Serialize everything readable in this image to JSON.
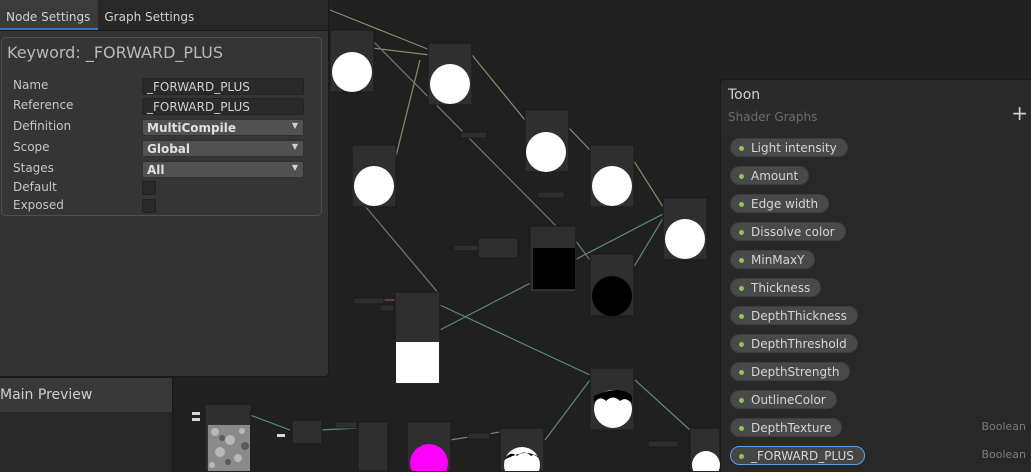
{
  "inspector": {
    "tabs": [
      {
        "label": "Node Settings",
        "active": true
      },
      {
        "label": "Graph Settings",
        "active": false
      }
    ],
    "title": "Keyword: _FORWARD_PLUS",
    "fields": {
      "name": {
        "label": "Name",
        "value": "_FORWARD_PLUS"
      },
      "reference": {
        "label": "Reference",
        "value": "_FORWARD_PLUS"
      },
      "definition": {
        "label": "Definition",
        "value": "MultiCompile"
      },
      "scope": {
        "label": "Scope",
        "value": "Global"
      },
      "stages": {
        "label": "Stages",
        "value": "All"
      },
      "default": {
        "label": "Default",
        "checked": false
      },
      "exposed": {
        "label": "Exposed",
        "checked": false
      }
    }
  },
  "preview": {
    "title": "Main Preview"
  },
  "blackboard": {
    "title": "Toon",
    "subtitle": "Shader Graphs",
    "add_icon": "plus-icon",
    "items": [
      {
        "label": "Light intensity",
        "type": ""
      },
      {
        "label": "Amount",
        "type": ""
      },
      {
        "label": "Edge width",
        "type": ""
      },
      {
        "label": "Dissolve color",
        "type": ""
      },
      {
        "label": "MinMaxY",
        "type": ""
      },
      {
        "label": "Thickness",
        "type": ""
      },
      {
        "label": "DepthThickness",
        "type": ""
      },
      {
        "label": "DepthThreshold",
        "type": ""
      },
      {
        "label": "DepthStrength",
        "type": ""
      },
      {
        "label": "OutlineColor",
        "type": ""
      },
      {
        "label": "DepthTexture",
        "type": "Boolean"
      },
      {
        "label": "_FORWARD_PLUS",
        "type": "Boolean",
        "selected": true
      }
    ]
  },
  "colors": {
    "canvas": "#202020",
    "panel": "#333333",
    "accent": "#3a79bb",
    "property_dot": "#8fc45a",
    "edge_vector": "#8b8b67",
    "edge_float": "#6c8c86",
    "swatch_magenta": "#ff00ff"
  }
}
